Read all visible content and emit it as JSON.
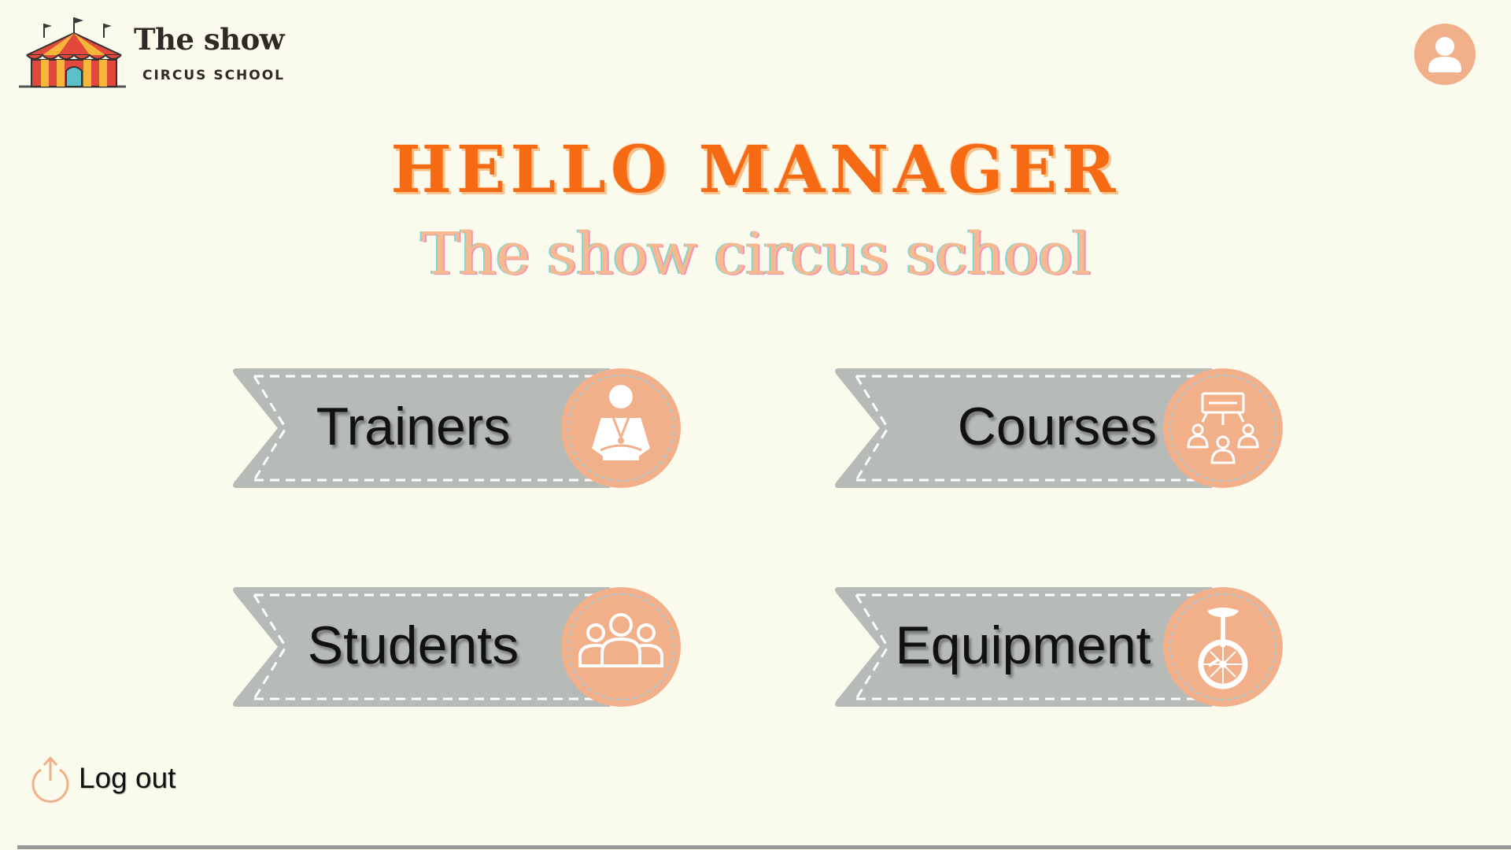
{
  "brand": {
    "title": "The show",
    "subtitle": "CIRCUS SCHOOL"
  },
  "header": {
    "profile_icon": "user-icon"
  },
  "hero": {
    "greeting": "HELLO MANAGER",
    "subtitle": "The show circus school"
  },
  "menu": {
    "trainers": {
      "label": "Trainers",
      "icon": "trainer-icon"
    },
    "courses": {
      "label": "Courses",
      "icon": "presentation-group-icon"
    },
    "students": {
      "label": "Students",
      "icon": "group-icon"
    },
    "equipment": {
      "label": "Equipment",
      "icon": "unicycle-icon"
    }
  },
  "footer": {
    "logout_label": "Log out",
    "logout_icon": "logout-icon"
  },
  "colors": {
    "background": "#fbfbed",
    "accent": "#f66a14",
    "badge": "#f2b08a",
    "ribbon": "#b6bbb8",
    "subtitle": "#f7ba90"
  }
}
